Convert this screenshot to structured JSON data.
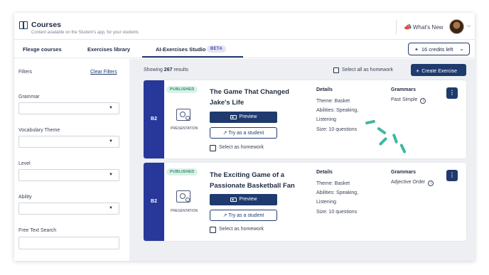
{
  "header": {
    "title": "Courses",
    "subtitle": "Content available on the Student's app, for your students",
    "whats_new": "What's New",
    "icons": {
      "book": "book-icon",
      "megaphone": "megaphone-icon",
      "chevron": "chevron-down-icon"
    }
  },
  "tabs": [
    {
      "label": "Flexge courses"
    },
    {
      "label": "Exercises library"
    },
    {
      "label": "AI-Exercises Studio",
      "badge": "BETA",
      "active": true
    }
  ],
  "credits": {
    "label": "16 credits left",
    "icon": "sparkle-icon"
  },
  "filters": {
    "title": "Filters",
    "clear": "Clear Filters",
    "grammar": "Grammar",
    "vocabulary": "Vocabulary Theme",
    "level": "Level",
    "ability": "Ability",
    "free_text": "Free Text Search"
  },
  "results": {
    "prefix": "Showing ",
    "count": "267",
    "suffix": " results",
    "select_all": "Select all as homework",
    "create": "Create Exercise"
  },
  "cards": [
    {
      "level": "B2",
      "status": "PUBLISHED",
      "type": "PRESENTATION",
      "title": "The Game That Changed Jake's Life",
      "preview": "Preview",
      "try": "Try as a student",
      "homework": "Select as homework",
      "details_title": "Details",
      "theme": "Theme: Basket",
      "abilities": "Abilities: Speaking, Listening",
      "size": "Size:  10 questions",
      "grammars_title": "Grammars",
      "grammar": "Past Simple"
    },
    {
      "level": "B2",
      "status": "PUBLISHED",
      "type": "PRESENTATION",
      "title": "The Exciting Game of a Passionate Basketball Fan",
      "preview": "Preview",
      "try": "Try as a student",
      "homework": "Select as homework",
      "details_title": "Details",
      "theme": "Theme: Basket",
      "abilities": "Abilities: Speaking, Listening",
      "size": "Size:  10 questions",
      "grammars_title": "Grammars",
      "grammar": "Adjective Order"
    }
  ],
  "colors": {
    "primary": "#1f3a6e",
    "level_strip": "#27379a",
    "published": "#2a8c6e",
    "accent_loader": "#3fb7a0"
  }
}
